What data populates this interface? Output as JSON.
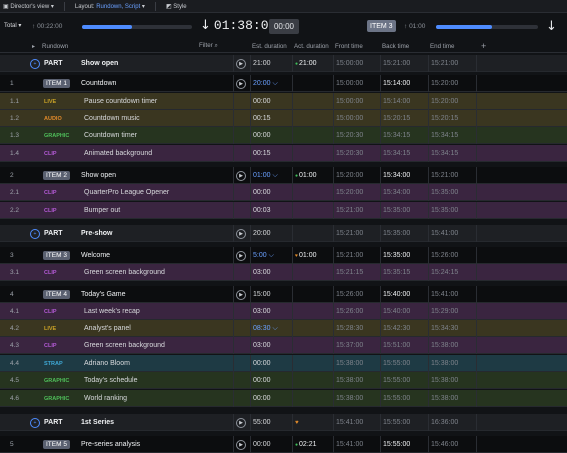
{
  "topbar": {
    "view": "Director's view",
    "layout_label": "Layout:",
    "layout_value": "Rundown, Script",
    "style": "Style"
  },
  "transport": {
    "total": "Total",
    "elapsed_left": "00:22:00",
    "main_time": "01:38:00",
    "small_time": "00:00",
    "item_badge": "ITEM 3",
    "elapsed_right": "01:00",
    "progress_left": 0.45,
    "progress_right": 0.55
  },
  "columns": {
    "rundown": "Rundown",
    "filter": "Filter",
    "est": "Est. duration",
    "act": "Act. duration",
    "front": "Front time",
    "back": "Back time",
    "end": "End time"
  },
  "rows": [
    {
      "kind": "part",
      "title": "Show open",
      "est": "21:00",
      "act": "21:00",
      "front": "15:00:00",
      "back": "15:21:00",
      "end": "15:21:00"
    },
    {
      "kind": "item",
      "idx": "1",
      "badge": "ITEM 1",
      "title": "Countdown",
      "est": "20:00",
      "front": "15:00:00",
      "back": "15:14:00",
      "end": "15:20:00"
    },
    {
      "kind": "sub",
      "idx": "1.1",
      "tag": "LIVE",
      "title": "Pause countdown timer",
      "est": "00:00",
      "front": "15:00:00",
      "back": "15:14:00",
      "end": "15:20:00"
    },
    {
      "kind": "sub",
      "idx": "1.2",
      "tag": "AUDIO",
      "title": "Countdown music",
      "est": "00:15",
      "front": "15:00:00",
      "back": "15:20:15",
      "end": "15:20:15"
    },
    {
      "kind": "sub",
      "idx": "1.3",
      "tag": "GRAPHIC",
      "title": "Countdown timer",
      "est": "00:00",
      "front": "15:20:30",
      "back": "15:34:15",
      "end": "15:34:15"
    },
    {
      "kind": "sub",
      "idx": "1.4",
      "tag": "CLIP",
      "title": "Animated background",
      "est": "00:15",
      "front": "15:20:30",
      "back": "15:34:15",
      "end": "15:34:15"
    },
    {
      "kind": "item",
      "idx": "2",
      "badge": "ITEM 2",
      "title": "Show open",
      "est": "01:00",
      "act": "01:00",
      "front": "15:20:00",
      "back": "15:34:00",
      "end": "15:21:00"
    },
    {
      "kind": "sub",
      "idx": "2.1",
      "tag": "CLIP",
      "title": "QuarterPro League Opener",
      "est": "00:00",
      "front": "15:20:00",
      "back": "15:34:00",
      "end": "15:35:00"
    },
    {
      "kind": "sub",
      "idx": "2.2",
      "tag": "CLIP",
      "title": "Bumper out",
      "est": "00:03",
      "front": "15:21:00",
      "back": "15:35:00",
      "end": "15:35:00"
    },
    {
      "kind": "part",
      "title": "Pre-show",
      "est": "20:00",
      "act": "",
      "front": "15:21:00",
      "back": "15:35:00",
      "end": "15:41:00"
    },
    {
      "kind": "item",
      "idx": "3",
      "badge": "ITEM 3",
      "title": "Welcome",
      "est": "5:00",
      "act": "01:00",
      "front": "15:21:00",
      "back": "15:35:00",
      "end": "15:26:00"
    },
    {
      "kind": "sub",
      "idx": "3.1",
      "tag": "CLIP",
      "title": "Green screen background",
      "est": "03:00",
      "front": "15:21:15",
      "back": "15:35:15",
      "end": "15:24:15"
    },
    {
      "kind": "item",
      "idx": "4",
      "badge": "ITEM 4",
      "title": "Today's Game",
      "est": "15:00",
      "act": "",
      "front": "15:26:00",
      "back": "15:40:00",
      "end": "15:41:00"
    },
    {
      "kind": "sub",
      "idx": "4.1",
      "tag": "CLIP",
      "title": "Last week's recap",
      "est": "03:00",
      "front": "15:26:00",
      "back": "15:40:00",
      "end": "15:29:00"
    },
    {
      "kind": "sub",
      "idx": "4.2",
      "tag": "LIVE",
      "title": "Analyst's panel",
      "est": "08:30",
      "front": "15:28:30",
      "back": "15:42:30",
      "end": "15:34:30"
    },
    {
      "kind": "sub",
      "idx": "4.3",
      "tag": "CLIP",
      "title": "Green screen background",
      "est": "03:00",
      "front": "15:37:00",
      "back": "15:51:00",
      "end": "15:38:00"
    },
    {
      "kind": "sub",
      "idx": "4.4",
      "tag": "STRAP",
      "title": "Adriano Bloom",
      "est": "00:00",
      "front": "15:38:00",
      "back": "15:55:00",
      "end": "15:38:00"
    },
    {
      "kind": "sub",
      "idx": "4.5",
      "tag": "GRAPHIC",
      "title": "Today's schedule",
      "est": "00:00",
      "front": "15:38:00",
      "back": "15:55:00",
      "end": "15:38:00"
    },
    {
      "kind": "sub",
      "idx": "4.6",
      "tag": "GRAPHIC",
      "title": "World ranking",
      "est": "00:00",
      "front": "15:38:00",
      "back": "15:55:00",
      "end": "15:38:00"
    },
    {
      "kind": "part",
      "title": "1st Series",
      "est": "55:00",
      "act": "",
      "front": "15:41:00",
      "back": "15:55:00",
      "end": "16:36:00"
    },
    {
      "kind": "item",
      "idx": "5",
      "badge": "ITEM 5",
      "title": "Pre-series analysis",
      "est": "00:00",
      "act": "02:21",
      "front": "15:41:00",
      "back": "15:55:00",
      "end": "15:46:00"
    }
  ],
  "colors": {
    "LIVE": "#c9a227",
    "AUDIO": "#e08a2a",
    "GRAPHIC": "#4fbf5a",
    "CLIP": "#b45ad6",
    "STRAP": "#3fa9d6"
  }
}
